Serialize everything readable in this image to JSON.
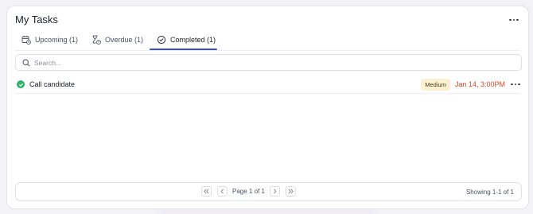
{
  "header": {
    "title": "My Tasks"
  },
  "tabs": [
    {
      "label": "Upcoming (1)",
      "icon": "calendar-clock-icon"
    },
    {
      "label": "Overdue (1)",
      "icon": "hourglass-alert-icon"
    },
    {
      "label": "Completed (1)",
      "icon": "check-circle-icon",
      "active": true
    }
  ],
  "search": {
    "placeholder": "Search..."
  },
  "tasks": [
    {
      "name": "Call candidate",
      "status": "completed",
      "priority": "Medium",
      "due": "Jan 14, 3:00PM"
    }
  ],
  "pagination": {
    "page_info": "Page 1 of 1",
    "showing": "Showing 1-1 of 1"
  },
  "colors": {
    "accent": "#3e4ec8",
    "complete": "#2fb36c",
    "overdue_text": "#e0452b",
    "medium_badge_bg": "#fbf0d2"
  }
}
